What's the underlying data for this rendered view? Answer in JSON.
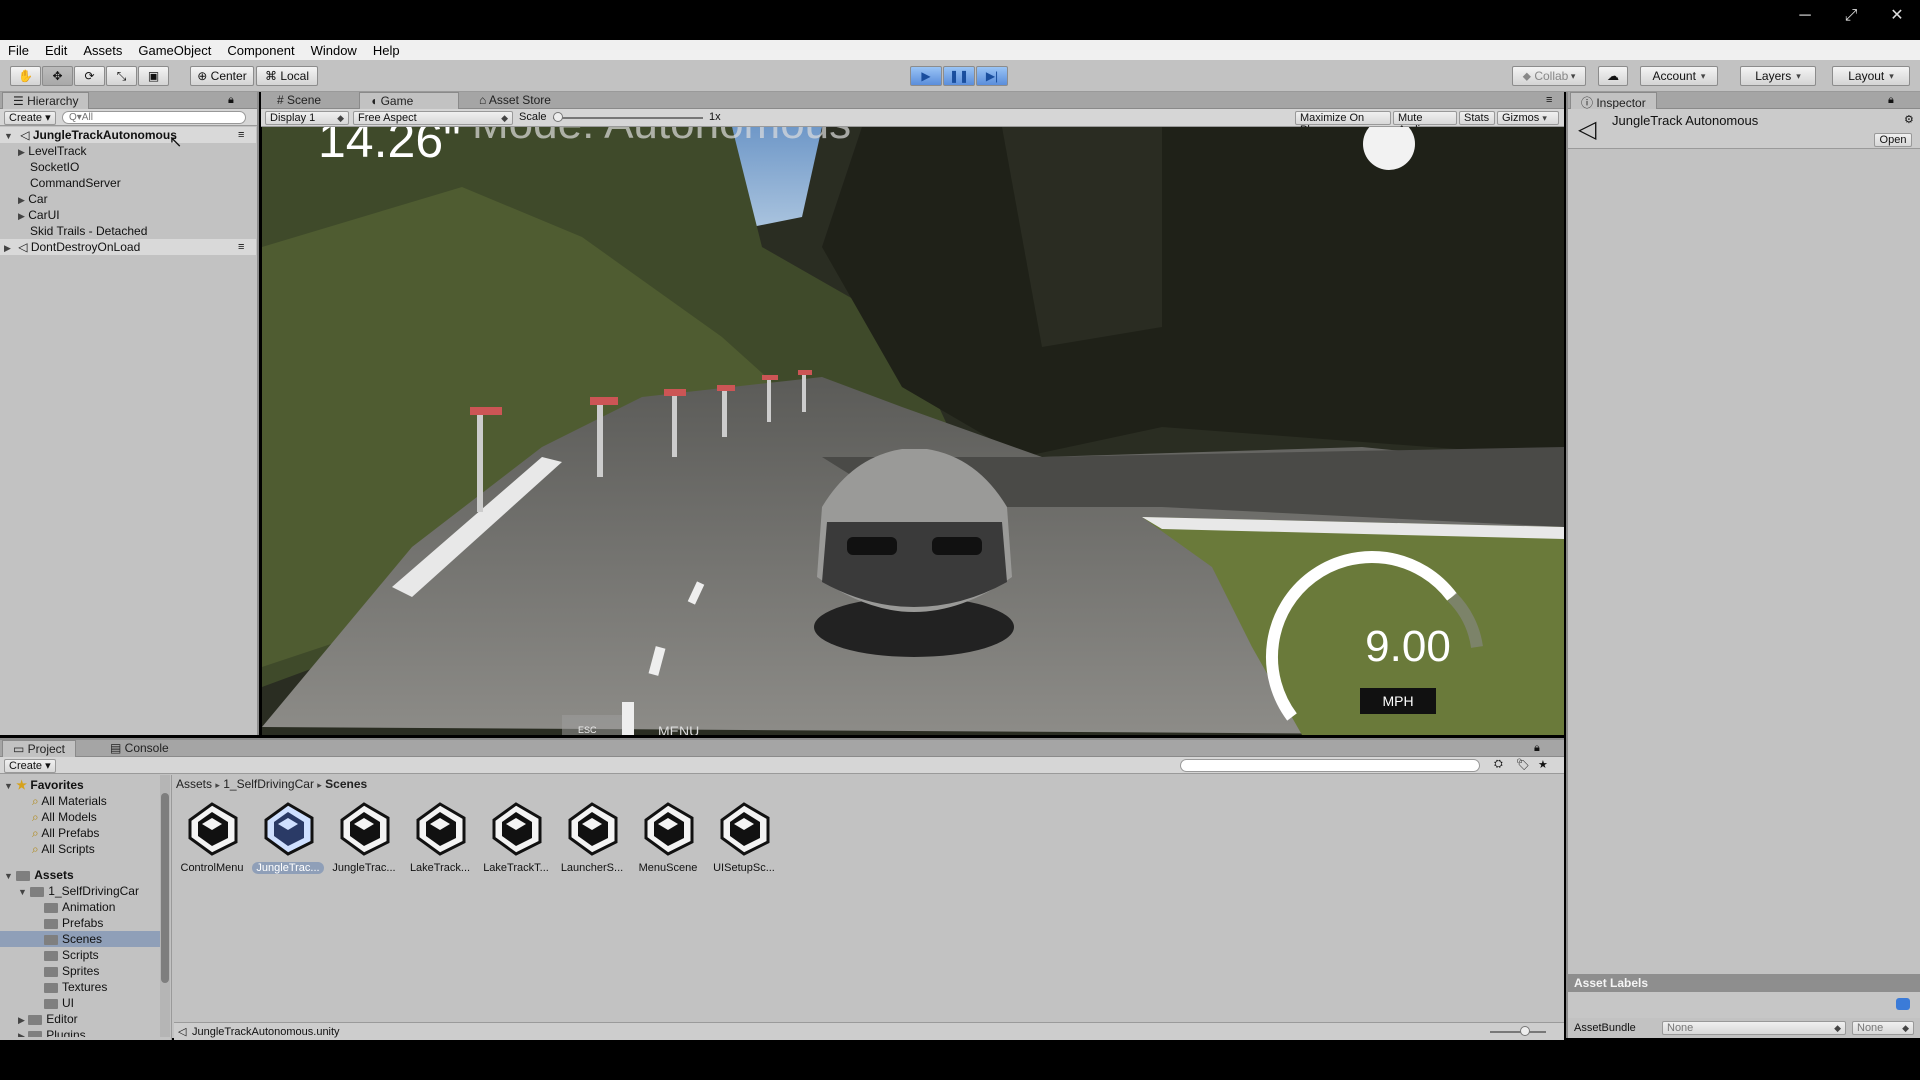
{
  "menu": [
    "File",
    "Edit",
    "Assets",
    "GameObject",
    "Component",
    "Window",
    "Help"
  ],
  "toolbar": {
    "center_label": "Center",
    "local_label": "Local",
    "collab_label": "Collab",
    "account_label": "Account",
    "layers_label": "Layers",
    "layout_label": "Layout"
  },
  "hierarchy": {
    "tab": "Hierarchy",
    "create": "Create",
    "search_placeholder": "Q▾All",
    "scene_name": "JungleTrackAutonomous",
    "items": [
      "LevelTrack",
      "SocketIO",
      "CommandServer",
      "Car",
      "CarUI",
      "Skid Trails - Detached"
    ],
    "dontdestroy": "DontDestroyOnLoad"
  },
  "center_tabs": {
    "scene": "Scene",
    "game": "Game",
    "asset_store": "Asset Store"
  },
  "game_bar": {
    "display": "Display 1",
    "aspect": "Free Aspect",
    "scale_label": "Scale",
    "scale_value": "1x",
    "maximize": "Maximize On Play",
    "mute": "Mute Audio",
    "stats": "Stats",
    "gizmos": "Gizmos"
  },
  "game_view": {
    "timer": "14.26\"",
    "mode_text": "Mode: Autonomous",
    "speed": "9.00",
    "speed_unit": "MPH",
    "speed_fraction": 0.3,
    "menu_text": "MENU",
    "esc_text": "ESC"
  },
  "inspector": {
    "tab": "Inspector",
    "title": "JungleTrack Autonomous",
    "open_button": "Open",
    "asset_labels": "Asset Labels",
    "asset_bundle": "AssetBundle",
    "bundle_value": "None",
    "bundle_variant": "None"
  },
  "project": {
    "tab_project": "Project",
    "tab_console": "Console",
    "create": "Create",
    "favorites_header": "Favorites",
    "favorites": [
      "All Materials",
      "All Models",
      "All Prefabs",
      "All Scripts"
    ],
    "assets_header": "Assets",
    "tree": {
      "root": "1_SelfDrivingCar",
      "children": [
        "Animation",
        "Prefabs",
        "Scenes",
        "Scripts",
        "Sprites",
        "Textures",
        "UI"
      ],
      "editor": "Editor",
      "plugins": "Plugins"
    },
    "breadcrumb": [
      "Assets",
      "1_SelfDrivingCar",
      "Scenes"
    ],
    "assets": [
      "ControlMenu",
      "JungleTrac...",
      "JungleTrac...",
      "LakeTrack...",
      "LakeTrackT...",
      "LauncherS...",
      "MenuScene",
      "UISetupSc..."
    ],
    "selected_index": 1,
    "footer_path": "JungleTrackAutonomous.unity"
  },
  "colors": {
    "pane_bg": "#c2c2c2",
    "selected_row": "#8f9fb8",
    "play_blue": "#5a8ddb"
  }
}
